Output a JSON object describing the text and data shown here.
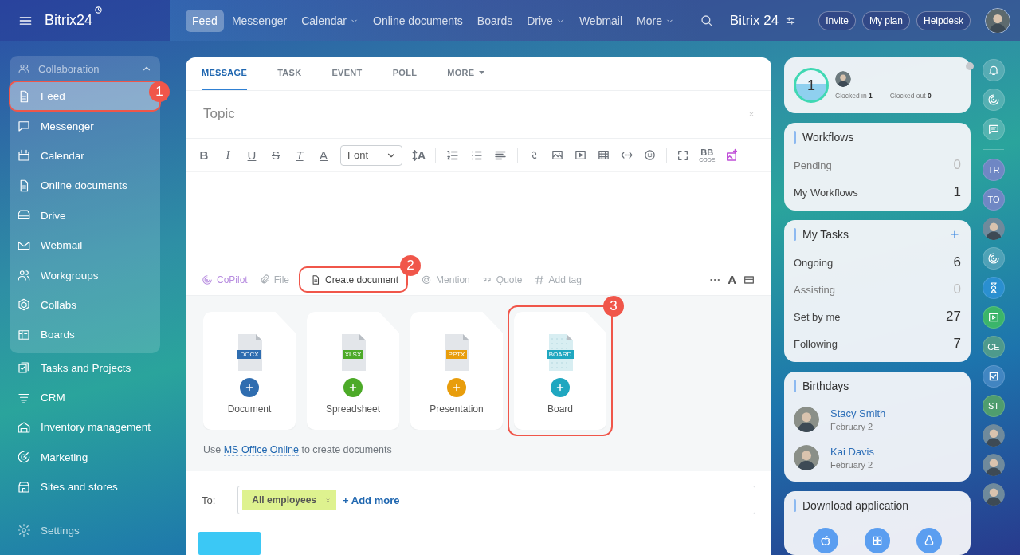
{
  "header": {
    "logo": "Bitrix24",
    "nav": [
      {
        "label": "Feed",
        "selected": true,
        "dropdown": false
      },
      {
        "label": "Messenger",
        "selected": false,
        "dropdown": false
      },
      {
        "label": "Calendar",
        "selected": false,
        "dropdown": true
      },
      {
        "label": "Online documents",
        "selected": false,
        "dropdown": false
      },
      {
        "label": "Boards",
        "selected": false,
        "dropdown": false
      },
      {
        "label": "Drive",
        "selected": false,
        "dropdown": true
      },
      {
        "label": "Webmail",
        "selected": false,
        "dropdown": false
      },
      {
        "label": "More",
        "selected": false,
        "dropdown": true
      }
    ],
    "portal_title": "Bitrix 24",
    "buttons": [
      "Invite",
      "My plan",
      "Helpdesk"
    ]
  },
  "sidebar": {
    "group": {
      "title": "Collaboration",
      "expanded": true,
      "items": [
        {
          "label": "Feed",
          "selected": true,
          "callout": "1"
        },
        {
          "label": "Messenger",
          "selected": false
        },
        {
          "label": "Calendar",
          "selected": false
        },
        {
          "label": "Online documents",
          "selected": false
        },
        {
          "label": "Drive",
          "selected": false
        },
        {
          "label": "Webmail",
          "selected": false
        },
        {
          "label": "Workgroups",
          "selected": false
        },
        {
          "label": "Collabs",
          "selected": false
        },
        {
          "label": "Boards",
          "selected": false
        }
      ]
    },
    "items": [
      {
        "label": "Tasks and Projects",
        "selected": false
      },
      {
        "label": "CRM",
        "selected": false
      },
      {
        "label": "Inventory management",
        "selected": false
      },
      {
        "label": "Marketing",
        "selected": false
      },
      {
        "label": "Sites and stores",
        "selected": false
      }
    ],
    "settings": "Settings"
  },
  "composer": {
    "tabs": [
      {
        "label": "MESSAGE",
        "selected": true,
        "dropdown": false
      },
      {
        "label": "TASK",
        "selected": false,
        "dropdown": false
      },
      {
        "label": "EVENT",
        "selected": false,
        "dropdown": false
      },
      {
        "label": "POLL",
        "selected": false,
        "dropdown": false
      },
      {
        "label": "MORE",
        "selected": false,
        "dropdown": true
      }
    ],
    "topic": {
      "placeholder": "Topic"
    },
    "format_buttons": [
      {
        "glyph": "B",
        "kind": "bold"
      },
      {
        "glyph": "I",
        "kind": "italic"
      },
      {
        "glyph": "U",
        "kind": "underline"
      },
      {
        "glyph": "S",
        "kind": "strike"
      },
      {
        "glyph": "T",
        "kind": "clear"
      },
      {
        "glyph": "A",
        "kind": "color"
      }
    ],
    "font_select": "Font",
    "font_size_glyph": "A",
    "bbcode": {
      "top": "BB",
      "bottom": "CODE"
    },
    "actions": [
      {
        "label": "CoPilot",
        "kind": "copilot"
      },
      {
        "label": "File",
        "kind": "file"
      },
      {
        "label": "Create document",
        "kind": "document",
        "callout": "2"
      },
      {
        "label": "Mention",
        "kind": "mention"
      },
      {
        "label": "Quote",
        "kind": "quote"
      },
      {
        "label": "Add tag",
        "kind": "tag"
      }
    ],
    "text_style_glyph": "A",
    "documents": [
      {
        "label": "Document",
        "ext": "DOCX",
        "color": "#2f6db0",
        "kind": "file"
      },
      {
        "label": "Spreadsheet",
        "ext": "XLSX",
        "color": "#4caa28",
        "kind": "file"
      },
      {
        "label": "Presentation",
        "ext": "PPTX",
        "color": "#e89d0c",
        "kind": "file"
      },
      {
        "label": "Board",
        "ext": "BOARD",
        "color": "#1fa7c0",
        "kind": "board",
        "callout": "3"
      }
    ],
    "hint": {
      "before": "Use",
      "link": "MS Office Online",
      "after": "to create documents"
    },
    "recipients": {
      "label": "To:",
      "tags": [
        "All employees"
      ],
      "add": "+ Add more"
    }
  },
  "widgets": {
    "timeman": {
      "count": "1",
      "clocked_in_label": "Clocked in",
      "clocked_in": "1",
      "clocked_out_label": "Clocked out",
      "clocked_out": "0"
    },
    "workflows": {
      "title": "Workflows",
      "rows": [
        {
          "label": "Pending",
          "value": "0",
          "active": false
        },
        {
          "label": "My Workflows",
          "value": "1",
          "active": true
        }
      ]
    },
    "tasks": {
      "title": "My Tasks",
      "rows": [
        {
          "label": "Ongoing",
          "value": "6",
          "active": true
        },
        {
          "label": "Assisting",
          "value": "0",
          "active": false
        },
        {
          "label": "Set by me",
          "value": "27",
          "active": true
        },
        {
          "label": "Following",
          "value": "7",
          "active": true
        }
      ]
    },
    "birthdays": {
      "title": "Birthdays",
      "people": [
        {
          "name": "Stacy Smith",
          "date": "February 2"
        },
        {
          "name": "Kai Davis",
          "date": "February 2"
        }
      ]
    },
    "download": {
      "title": "Download application"
    }
  },
  "rail": [
    {
      "kind": "bell"
    },
    {
      "kind": "copilot"
    },
    {
      "kind": "chat"
    },
    {
      "kind": "divider"
    },
    {
      "kind": "initials",
      "initials": "TR",
      "color": "#6f87c4"
    },
    {
      "kind": "initials",
      "initials": "TO",
      "color": "#6f87c4"
    },
    {
      "kind": "photo"
    },
    {
      "kind": "copilot"
    },
    {
      "kind": "timer"
    },
    {
      "kind": "video"
    },
    {
      "kind": "initials",
      "initials": "CE",
      "color": "#4e9a8c"
    },
    {
      "kind": "tasks"
    },
    {
      "kind": "initials",
      "initials": "ST",
      "color": "#4f9d6e"
    },
    {
      "kind": "photo"
    },
    {
      "kind": "photo"
    },
    {
      "kind": "photo"
    }
  ]
}
